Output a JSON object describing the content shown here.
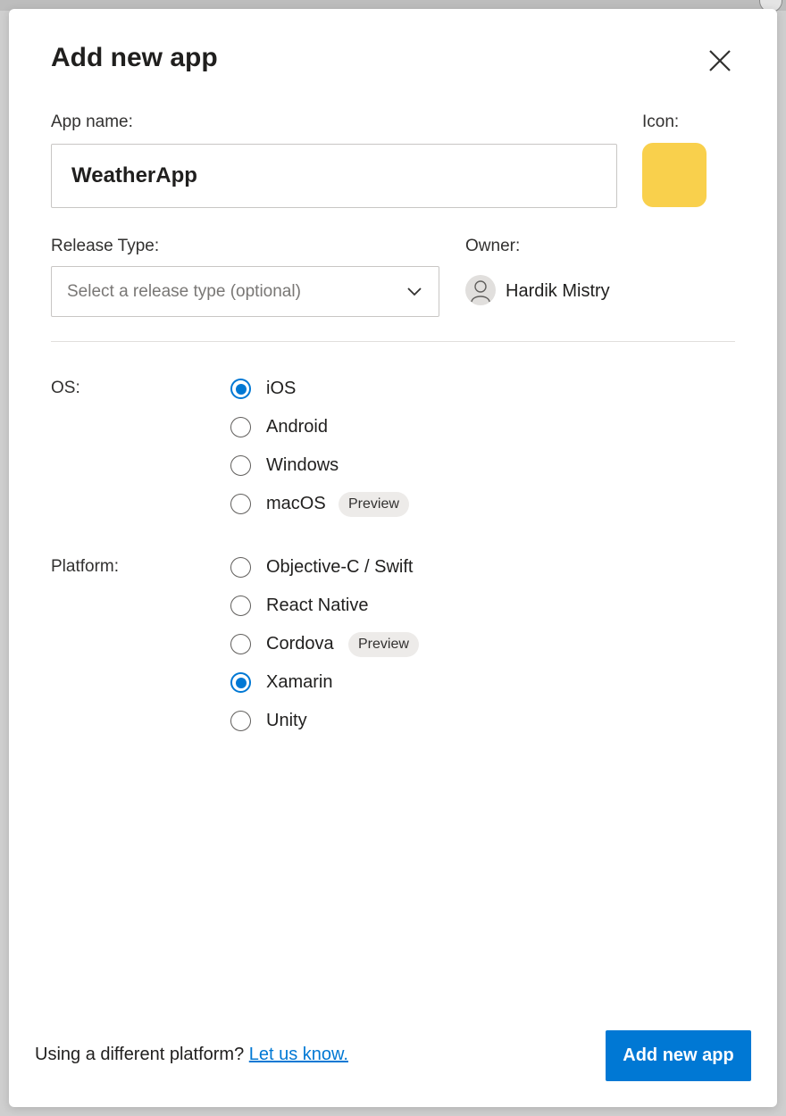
{
  "dialog": {
    "title": "Add new app",
    "close_icon": "close-icon"
  },
  "app_name": {
    "label": "App name:",
    "value": "WeatherApp"
  },
  "icon": {
    "label": "Icon:",
    "color": "#f9d04c"
  },
  "release_type": {
    "label": "Release Type:",
    "placeholder": "Select a release type (optional)",
    "chevron_icon": "chevron-down-icon"
  },
  "owner": {
    "label": "Owner:",
    "name": "Hardik Mistry",
    "avatar_icon": "person-icon"
  },
  "os": {
    "label": "OS:",
    "options": [
      {
        "label": "iOS",
        "checked": true
      },
      {
        "label": "Android",
        "checked": false
      },
      {
        "label": "Windows",
        "checked": false
      },
      {
        "label": "macOS",
        "checked": false,
        "badge": "Preview"
      }
    ]
  },
  "platform": {
    "label": "Platform:",
    "options": [
      {
        "label": "Objective-C / Swift",
        "checked": false
      },
      {
        "label": "React Native",
        "checked": false
      },
      {
        "label": "Cordova",
        "checked": false,
        "badge": "Preview"
      },
      {
        "label": "Xamarin",
        "checked": true
      },
      {
        "label": "Unity",
        "checked": false
      }
    ]
  },
  "footer": {
    "prompt": "Using a different platform?",
    "link": "Let us know.",
    "submit": "Add new app"
  },
  "colors": {
    "accent": "#0078d4",
    "icon_swatch": "#f9d04c"
  }
}
